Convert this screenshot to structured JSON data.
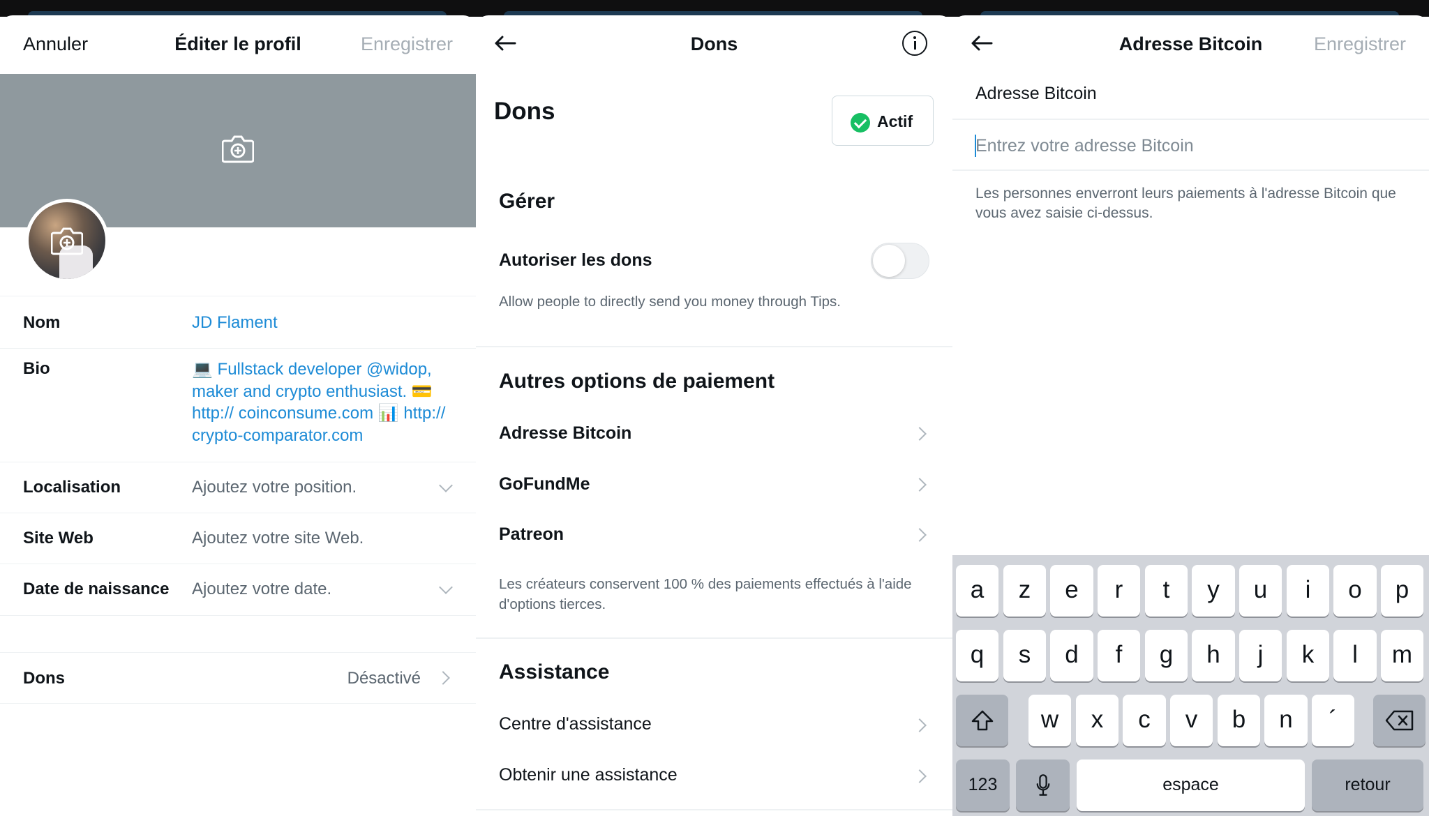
{
  "edit_profile": {
    "cancel": "Annuler",
    "title": "Éditer le profil",
    "save": "Enregistrer",
    "fields": {
      "name_label": "Nom",
      "name_value": "JD Flament",
      "bio_label": "Bio",
      "bio_value": "💻 Fullstack developer @widop, maker and crypto enthusiast. 💳 http:// coinconsume.com 📊 http:// crypto-comparator.com",
      "location_label": "Localisation",
      "location_placeholder": "Ajoutez votre position.",
      "website_label": "Site Web",
      "website_placeholder": "Ajoutez votre site Web.",
      "birthdate_label": "Date de naissance",
      "birthdate_placeholder": "Ajoutez votre date.",
      "tips_label": "Dons",
      "tips_value": "Désactivé"
    }
  },
  "tips": {
    "nav_title": "Dons",
    "title": "Dons",
    "status": "Actif",
    "manage_heading": "Gérer",
    "allow_label": "Autoriser les dons",
    "allow_enabled": false,
    "allow_note": "Allow people to directly send you money through Tips.",
    "other_heading": "Autres options de paiement",
    "options": [
      "Adresse Bitcoin",
      "GoFundMe",
      "Patreon"
    ],
    "other_note": "Les créateurs conservent 100 % des paiements effectués à l'aide d'options tierces.",
    "support_heading": "Assistance",
    "support_items": [
      "Centre d'assistance",
      "Obtenir une assistance"
    ]
  },
  "bitcoin": {
    "title": "Adresse Bitcoin",
    "save": "Enregistrer",
    "field_label": "Adresse Bitcoin",
    "placeholder": "Entrez votre adresse Bitcoin",
    "help": "Les personnes enverront leurs paiements à l'adresse Bitcoin que vous avez saisie ci-dessus."
  },
  "keyboard": {
    "row1": [
      "a",
      "z",
      "e",
      "r",
      "t",
      "y",
      "u",
      "i",
      "o",
      "p"
    ],
    "row2": [
      "q",
      "s",
      "d",
      "f",
      "g",
      "h",
      "j",
      "k",
      "l",
      "m"
    ],
    "row3": [
      "w",
      "x",
      "c",
      "v",
      "b",
      "n",
      "´"
    ],
    "numbers": "123",
    "space": "espace",
    "return": "retour"
  },
  "colors": {
    "link_blue": "#1d8bd6",
    "active_green": "#17bf63",
    "banner_grey": "#8f999e"
  }
}
